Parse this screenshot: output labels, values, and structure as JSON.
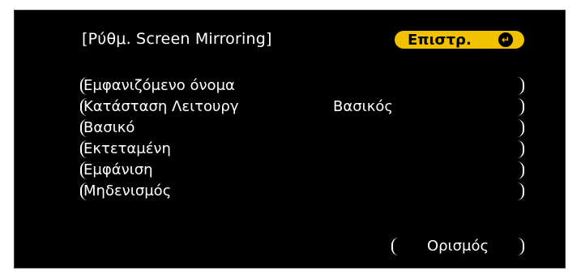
{
  "window": {
    "title": "[Ρύθμ. Screen Mirroring]"
  },
  "header": {
    "back_label": "Επιστρ.",
    "back_icon": "enter-icon"
  },
  "menu": {
    "items": [
      {
        "label": "Εμφανιζόμενο όνομα",
        "value": ""
      },
      {
        "label": "Κατάσταση Λειτουργ",
        "value": "Βασικός"
      },
      {
        "label": "Βασικό",
        "value": ""
      },
      {
        "label": "Εκτεταμένη",
        "value": ""
      },
      {
        "label": "Εμφάνιση",
        "value": ""
      },
      {
        "label": "Μηδενισμός",
        "value": ""
      }
    ]
  },
  "footer": {
    "set_label": "Ορισμός"
  },
  "colors": {
    "background": "#000000",
    "highlight": "#f2c200",
    "text": "#ffffff"
  }
}
